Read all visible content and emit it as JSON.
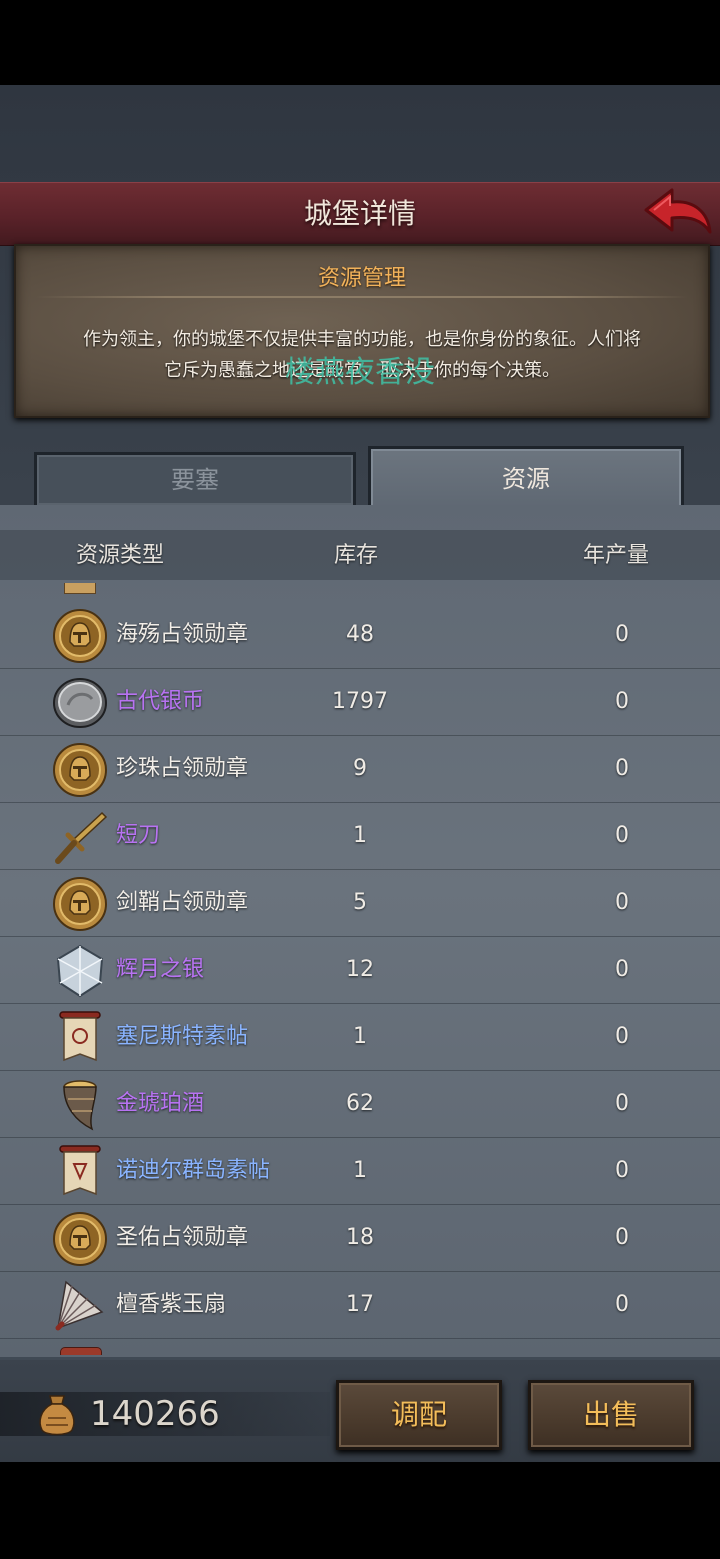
{
  "header": {
    "title": "城堡详情"
  },
  "info": {
    "title": "资源管理",
    "lines": [
      "作为领主，你的城堡不仅提供丰富的功能，也是你身份的象征。人们将",
      "它斥为愚蠢之地还是殿堂，取决于你的每个决策。"
    ]
  },
  "watermark": "楼燕夜香没",
  "tabs": {
    "fortress": "要塞",
    "resources": "资源"
  },
  "columns": {
    "type": "资源类型",
    "stock": "库存",
    "yield": "年产量"
  },
  "rows": [
    {
      "name": "海殇占领勋章",
      "stock": "48",
      "yield": "0",
      "color": "#f2eee8",
      "icon": "medal-icon"
    },
    {
      "name": "古代银币",
      "stock": "1797",
      "yield": "0",
      "color": "#b873f2",
      "icon": "silver-coin-icon"
    },
    {
      "name": "珍珠占领勋章",
      "stock": "9",
      "yield": "0",
      "color": "#f2eee8",
      "icon": "medal-icon"
    },
    {
      "name": "短刀",
      "stock": "1",
      "yield": "0",
      "color": "#b873f2",
      "icon": "dagger-icon"
    },
    {
      "name": "剑鞘占领勋章",
      "stock": "5",
      "yield": "0",
      "color": "#f2eee8",
      "icon": "medal-icon"
    },
    {
      "name": "辉月之银",
      "stock": "12",
      "yield": "0",
      "color": "#b873f2",
      "icon": "silver-crystal-icon"
    },
    {
      "name": "塞尼斯特素帖",
      "stock": "1",
      "yield": "0",
      "color": "#8ab4ff",
      "icon": "banner-icon"
    },
    {
      "name": "金琥珀酒",
      "stock": "62",
      "yield": "0",
      "color": "#b873f2",
      "icon": "horn-cup-icon"
    },
    {
      "name": "诺迪尔群岛素帖",
      "stock": "1",
      "yield": "0",
      "color": "#8ab4ff",
      "icon": "banner-icon"
    },
    {
      "name": "圣佑占领勋章",
      "stock": "18",
      "yield": "0",
      "color": "#f2eee8",
      "icon": "medal-icon"
    },
    {
      "name": "檀香紫玉扇",
      "stock": "17",
      "yield": "0",
      "color": "#f2eee8",
      "icon": "fan-icon"
    }
  ],
  "footer": {
    "money": "140266",
    "allocate": "调配",
    "sell": "出售"
  }
}
